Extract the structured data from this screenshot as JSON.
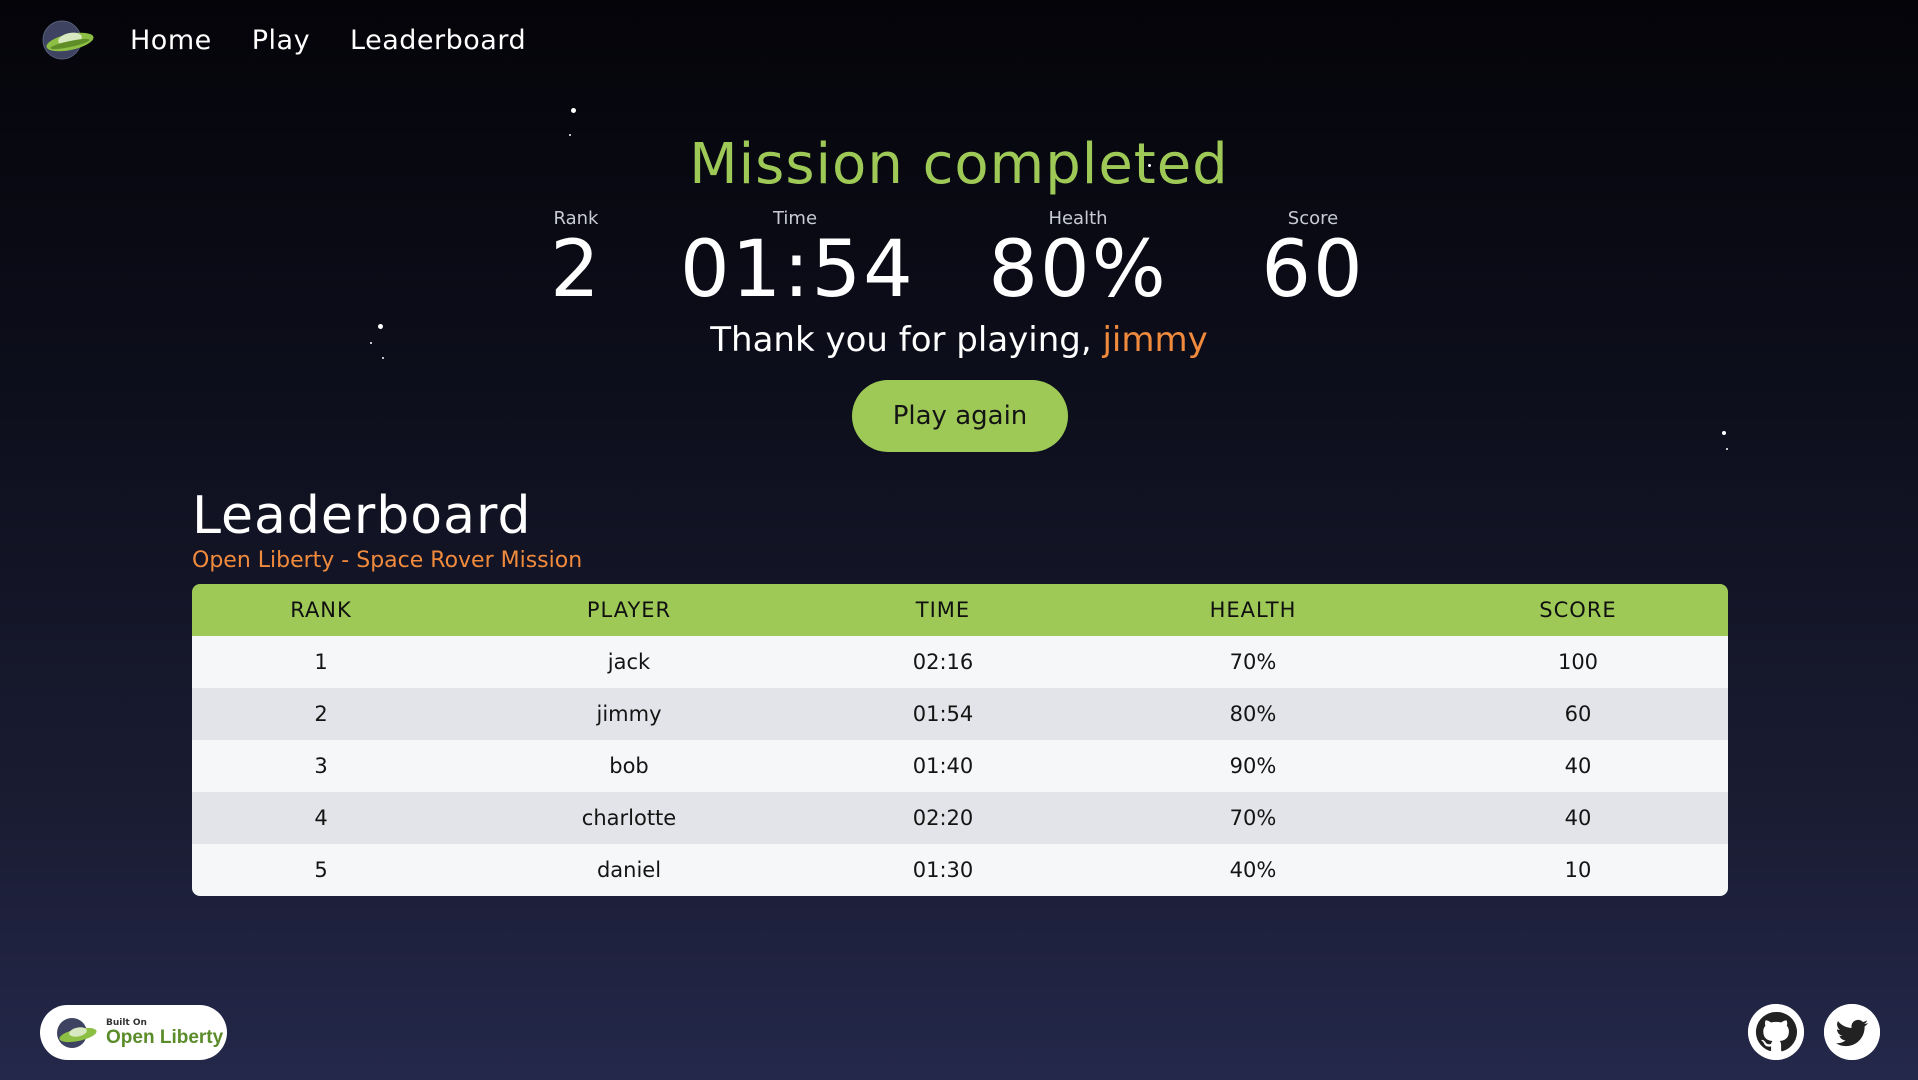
{
  "nav": {
    "logo_icon": "flying-saucer-icon",
    "links": [
      "Home",
      "Play",
      "Leaderboard"
    ]
  },
  "mission": {
    "title": "Mission completed",
    "stats": [
      {
        "label": "Rank",
        "value": "2"
      },
      {
        "label": "Time",
        "value": "01:54"
      },
      {
        "label": "Health",
        "value": "80%"
      },
      {
        "label": "Score",
        "value": "60"
      }
    ],
    "thanks_text": "Thank you for playing,",
    "player_name": "jimmy",
    "play_again_label": "Play again"
  },
  "leaderboard": {
    "heading": "Leaderboard",
    "subtitle": "Open Liberty - Space Rover Mission",
    "columns": [
      "RANK",
      "PLAYER",
      "TIME",
      "HEALTH",
      "SCORE"
    ],
    "rows": [
      [
        "1",
        "jack",
        "02:16",
        "70%",
        "100"
      ],
      [
        "2",
        "jimmy",
        "01:54",
        "80%",
        "60"
      ],
      [
        "3",
        "bob",
        "01:40",
        "90%",
        "40"
      ],
      [
        "4",
        "charlotte",
        "02:20",
        "70%",
        "40"
      ],
      [
        "5",
        "daniel",
        "01:30",
        "40%",
        "10"
      ]
    ]
  },
  "footer": {
    "badge_small": "Built On",
    "badge_big": "Open Liberty",
    "social_icons": [
      "github-icon",
      "twitter-icon"
    ]
  },
  "colors": {
    "accent_green": "#9ec957",
    "accent_orange": "#f08a3c",
    "background_top": "#040409",
    "background_bottom": "#24284a"
  }
}
